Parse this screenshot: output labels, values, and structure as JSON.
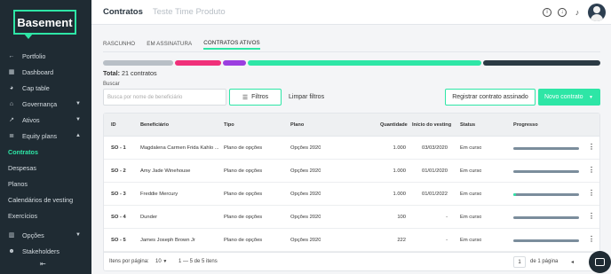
{
  "sidebar": {
    "logo": "Basement",
    "items": [
      {
        "label": "Portfolio",
        "icon": "arrow-left-icon"
      },
      {
        "label": "Dashboard",
        "icon": "dashboard-icon"
      },
      {
        "label": "Cap table",
        "icon": "pie-chart-icon"
      },
      {
        "label": "Governança",
        "icon": "bank-icon"
      },
      {
        "label": "Ativos",
        "icon": "trend-icon"
      },
      {
        "label": "Equity plans",
        "icon": "layers-icon"
      }
    ],
    "subitems": [
      "Contratos",
      "Despesas",
      "Planos",
      "Calendários de vesting",
      "Exercícios"
    ],
    "bottom_items": [
      {
        "label": "Opções",
        "icon": "bar-chart-icon"
      },
      {
        "label": "Stakeholders",
        "icon": "people-icon"
      }
    ],
    "collapse_glyph": "⇤"
  },
  "header": {
    "title": "Contratos",
    "subtitle": "Teste Time Produto"
  },
  "tabs": [
    "RASCUNHO",
    "EM ASSINATURA",
    "CONTRATOS ATIVOS"
  ],
  "active_tab": 2,
  "status_segments": [
    {
      "color": "#b8bfc6"
    },
    {
      "color": "#f0307a"
    },
    {
      "color": "#9b3ee0"
    },
    {
      "color": "#2ee6a6"
    },
    {
      "color": "#2b3a44"
    }
  ],
  "total": {
    "label": "Total:",
    "value": "21 contratos"
  },
  "search": {
    "label": "Buscar",
    "placeholder": "Busca por nome de beneficiário"
  },
  "buttons": {
    "filtros": "Filtros",
    "limpar": "Limpar filtros",
    "registrar": "Registrar contrato assinado",
    "novo": "Novo contrato"
  },
  "table": {
    "headers": [
      "ID",
      "Beneficiário",
      "Tipo",
      "Plano",
      "Quantidade",
      "Início do vesting",
      "Status",
      "Progresso"
    ],
    "rows": [
      {
        "id": "SO - 1",
        "beneficiario": "Magdalena Carmen Frida Kahlo ...",
        "tipo": "Plano de opções",
        "plano": "Opções 2020",
        "quantidade": "1.000",
        "inicio": "03/03/2020",
        "status": "Em curso",
        "progress": 0
      },
      {
        "id": "SO - 2",
        "beneficiario": "Amy Jade Winehouse",
        "tipo": "Plano de opções",
        "plano": "Opções 2020",
        "quantidade": "1.000",
        "inicio": "01/01/2020",
        "status": "Em curso",
        "progress": 0
      },
      {
        "id": "SO - 3",
        "beneficiario": "Freddie Mercury",
        "tipo": "Plano de opções",
        "plano": "Opções 2020",
        "quantidade": "1.000",
        "inicio": "01/01/2022",
        "status": "Em curso",
        "progress": 0.04
      },
      {
        "id": "SO - 4",
        "beneficiario": "Dunder",
        "tipo": "Plano de opções",
        "plano": "Opções 2020",
        "quantidade": "100",
        "inicio": "-",
        "status": "Em curso",
        "progress": 0
      },
      {
        "id": "SO - 5",
        "beneficiario": "James Joseph Brown Jr",
        "tipo": "Plano de opções",
        "plano": "Opções 2020",
        "quantidade": "222",
        "inicio": "-",
        "status": "Em curso",
        "progress": 0
      }
    ]
  },
  "footer": {
    "per_page_label": "Itens por página:",
    "per_page_value": "10",
    "range": "1 — 5 de 5 itens",
    "page": "1",
    "page_of": "de 1 página"
  }
}
